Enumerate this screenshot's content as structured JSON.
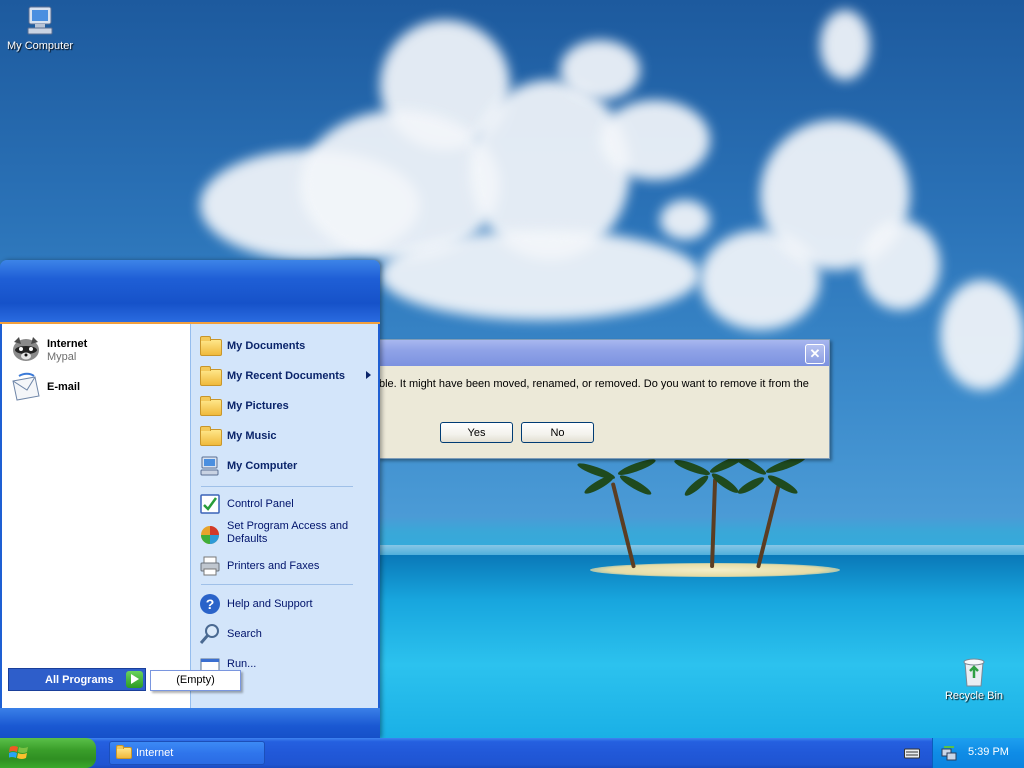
{
  "desktop": {
    "icons": [
      {
        "label": "My Computer"
      },
      {
        "label": "Recycle Bin"
      }
    ]
  },
  "dialog": {
    "message": "ble.  It might have been moved, renamed, or removed.  Do you want to remove it from the",
    "yes_label": "Yes",
    "no_label": "No",
    "close_glyph": "✕"
  },
  "start_menu": {
    "pinned": [
      {
        "label": "Internet",
        "sub": "Mypal"
      },
      {
        "label": "E-mail"
      }
    ],
    "places": [
      {
        "label": "My Documents"
      },
      {
        "label": "My Recent Documents"
      },
      {
        "label": "My Pictures"
      },
      {
        "label": "My Music"
      },
      {
        "label": "My Computer"
      }
    ],
    "system": [
      {
        "label": "Control Panel"
      },
      {
        "label": "Set Program Access and Defaults"
      },
      {
        "label": "Printers and Faxes"
      }
    ],
    "tools": [
      {
        "label": "Help and Support"
      },
      {
        "label": "Search"
      },
      {
        "label": "Run..."
      }
    ],
    "all_programs_label": "All Programs",
    "all_programs_submenu": "(Empty)"
  },
  "taskbar": {
    "tasks": [
      {
        "label": "Internet"
      }
    ],
    "clock": "5:39 PM"
  },
  "colors": {
    "start_button_green": "#3a9e2a",
    "taskbar_blue": "#2158d8",
    "tray_blue": "#0f8ce6",
    "menu_header_blue": "#1652c9",
    "menu_right_pane": "#d3e5fa",
    "dialog_face": "#ece9d8",
    "accent_orange": "#f2a03d"
  }
}
